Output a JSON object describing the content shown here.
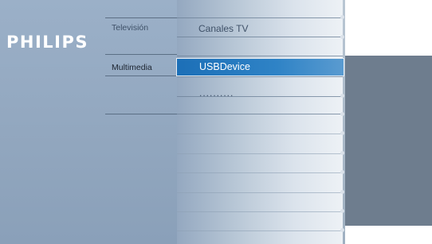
{
  "brand": "PHILIPS",
  "categories": [
    {
      "label": "Televisión",
      "active": false
    },
    {
      "label": "Multimedia",
      "active": true
    }
  ],
  "items": [
    {
      "label": "Canales TV",
      "selected": false
    },
    {
      "label": "USBDevice",
      "selected": true
    },
    {
      "label": "..........",
      "selected": false
    }
  ],
  "colors": {
    "selection": "#2a7ec3",
    "panel": "#91a6be",
    "preview": "#6e7d8e"
  }
}
